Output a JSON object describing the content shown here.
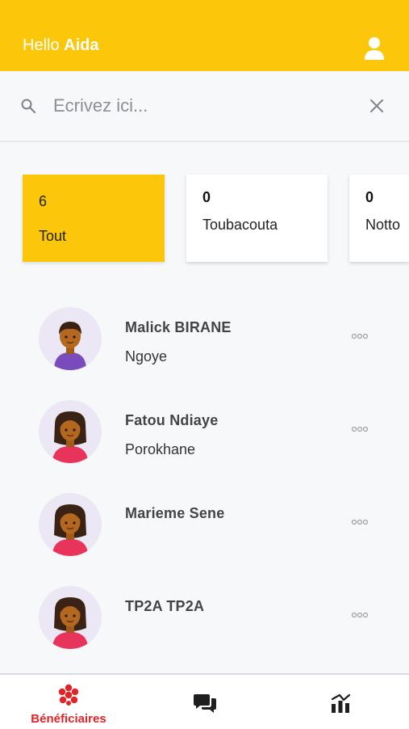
{
  "header": {
    "greeting": "Hello",
    "user_name": "Aida",
    "user_icon": "user-icon"
  },
  "search": {
    "placeholder": "Ecrivez ici...",
    "value": "",
    "search_icon": "search-icon",
    "clear_icon": "close-icon"
  },
  "filters": [
    {
      "count": "6",
      "label": "Tout",
      "active": true
    },
    {
      "count": "0",
      "label": "Toubacouta",
      "active": false
    },
    {
      "count": "0",
      "label": "Notto",
      "active": false
    }
  ],
  "beneficiaries": [
    {
      "name": "Malick BIRANE",
      "location": "Ngoye",
      "avatar": "man-avatar"
    },
    {
      "name": "Fatou  Ndiaye",
      "location": "Porokhane",
      "avatar": "woman-avatar"
    },
    {
      "name": "Marieme  Sene",
      "location": "",
      "avatar": "woman-avatar"
    },
    {
      "name": "TP2A TP2A",
      "location": "",
      "avatar": "woman-avatar"
    }
  ],
  "tabbar": {
    "tabs": [
      {
        "label": "Bénéficiaires",
        "icon": "beneficiaries-icon",
        "active": true
      },
      {
        "label": "",
        "icon": "chat-icon",
        "active": false
      },
      {
        "label": "",
        "icon": "stats-icon",
        "active": false
      }
    ]
  },
  "colors": {
    "accent": "#fcc60a",
    "active_tab": "#e0242a",
    "avatar_bg": "#ebe7f4"
  }
}
